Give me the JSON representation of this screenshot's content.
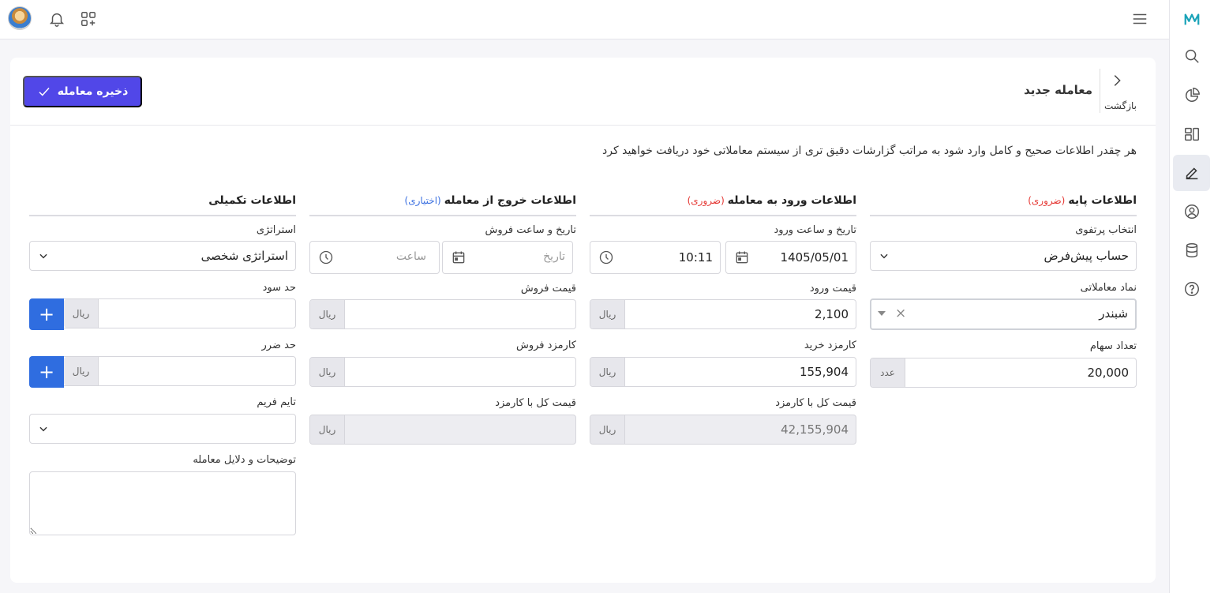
{
  "header": {
    "page_title": "معامله جدید",
    "back_label": "بازگشت",
    "save_label": "ذخیره معامله"
  },
  "intro_text": "هر چقدر اطلاعات صحیح و کامل وارد شود به مراتب گزارشات دقیق تری از سیستم معاملاتی خود دریافت خواهید کرد",
  "base": {
    "title": "اطلاعات پایه",
    "tag": "(ضروری)",
    "portfolio_label": "انتخاب پرتفوی",
    "portfolio_value": "حساب پیش‌فرض",
    "symbol_label": "نماد معاملاتی",
    "symbol_value": "شبندر",
    "symbol_clear": "×",
    "shares_label": "تعداد سهام",
    "shares_value": "20,000",
    "shares_unit": "عدد"
  },
  "entry": {
    "title": "اطلاعات ورود به معامله",
    "tag": "(ضروری)",
    "datetime_label": "تاریخ و ساعت ورود",
    "date_value": "1405/05/01",
    "time_value": "10:11",
    "price_label": "قیمت ورود",
    "price_value": "2,100",
    "fee_label": "کارمزد خرید",
    "fee_value": "155,904",
    "total_label": "قیمت کل با کارمزد",
    "total_value": "42,155,904",
    "unit": "ریال"
  },
  "exit": {
    "title": "اطلاعات خروج از معامله",
    "tag": "(اختیاری)",
    "datetime_label": "تاریخ و ساعت فروش",
    "date_placeholder": "تاریخ",
    "time_placeholder": "ساعت",
    "price_label": "قیمت فروش",
    "fee_label": "کارمزد فروش",
    "total_label": "قیمت کل با کارمزد",
    "unit": "ریال"
  },
  "extra": {
    "title": "اطلاعات تکمیلی",
    "strategy_label": "استراتژی",
    "strategy_value": "استراتژی شخصی",
    "tp_label": "حد سود",
    "sl_label": "حد ضرر",
    "unit": "ریال",
    "plus": "+",
    "timeframe_label": "تایم فریم",
    "notes_label": "توضیحات و دلایل معامله"
  },
  "colors": {
    "primary": "#5147e8",
    "plus_button": "#2f6de0",
    "required": "#e53935",
    "optional": "#3a6fe0",
    "logo": "#1aa3b8"
  },
  "icons": [
    "logo-icon",
    "search-icon",
    "pie-chart-icon",
    "dashboard-icon",
    "edit-icon",
    "user-icon",
    "database-icon",
    "help-icon",
    "menu-icon",
    "bell-icon",
    "apps-add-icon",
    "calendar-icon",
    "clock-icon",
    "chevron-down-icon",
    "check-icon",
    "chevron-right-icon"
  ]
}
